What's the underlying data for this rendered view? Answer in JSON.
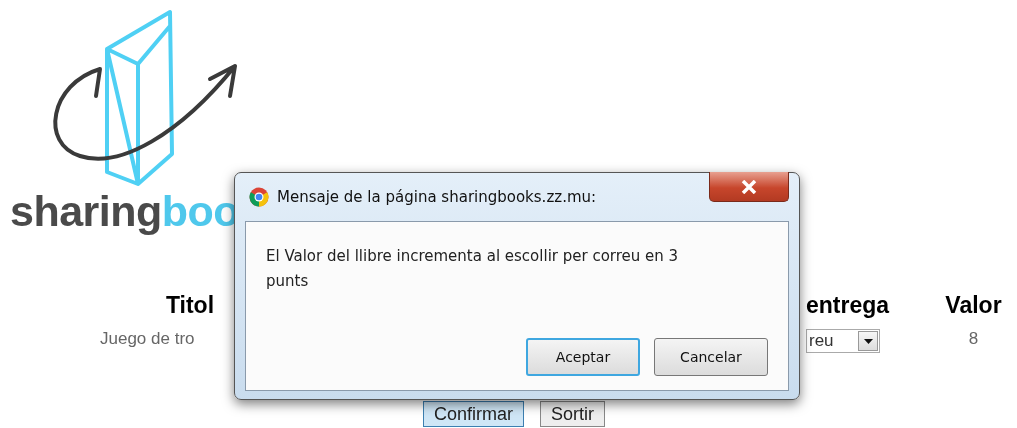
{
  "logo": {
    "text_dark": "sharing",
    "text_light": "boo"
  },
  "table": {
    "columns": [
      "Titol",
      "entrega",
      "Valor"
    ],
    "rows": [
      {
        "title": "Juego de tro",
        "delivery": "reu",
        "value": "8"
      }
    ]
  },
  "buttons": [
    {
      "label": "Confirmar",
      "selected": true
    },
    {
      "label": "Sortir",
      "selected": false
    }
  ],
  "dialog": {
    "title": "Mensaje de la página sharingbooks.zz.mu:",
    "message": "El Valor del llibre incrementa al escollir per correu en 3 punts",
    "buttons": [
      {
        "label": "Aceptar",
        "selected": true
      },
      {
        "label": "Cancelar",
        "selected": false
      }
    ]
  }
}
